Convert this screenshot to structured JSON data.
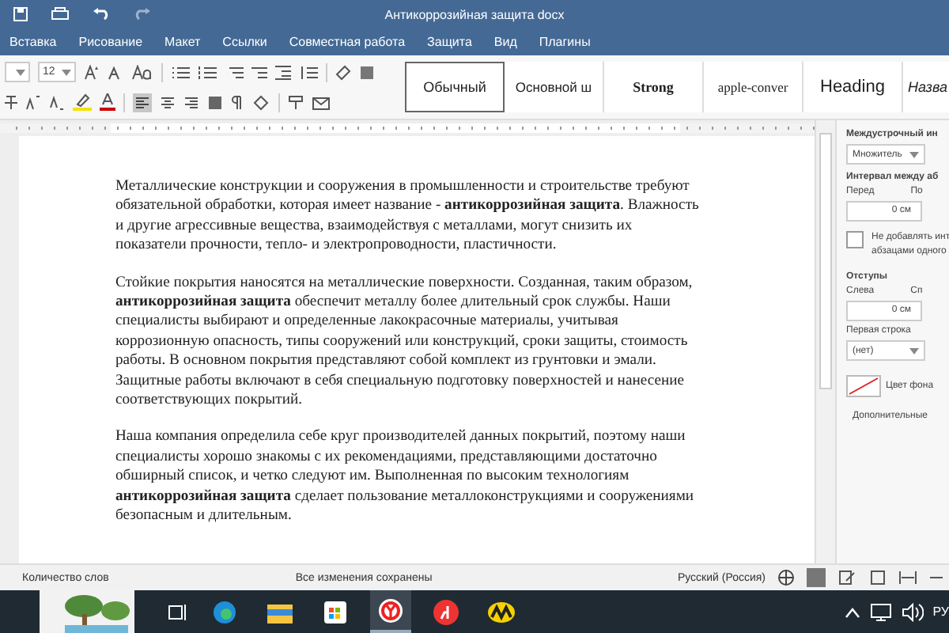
{
  "window": {
    "title": "Антикоррозийная защита docx"
  },
  "menu": [
    {
      "label": "Вставка",
      "selected": false
    },
    {
      "label": "Рисование",
      "selected": false
    },
    {
      "label": "Макет",
      "selected": false
    },
    {
      "label": "Ссылки",
      "selected": false
    },
    {
      "label": "Совместная работа",
      "selected": false
    },
    {
      "label": "Защита",
      "selected": false
    },
    {
      "label": "Вид",
      "selected": false
    },
    {
      "label": "Плагины",
      "selected": false
    }
  ],
  "toolbar": {
    "font_size": "12",
    "styles": [
      {
        "label": "Обычный",
        "kind": "normal",
        "selected": true
      },
      {
        "label": "Основной ш",
        "kind": "body",
        "selected": false
      },
      {
        "label": "Strong",
        "kind": "strong",
        "selected": false
      },
      {
        "label": "apple-conver",
        "kind": "serif",
        "selected": false
      },
      {
        "label": "Heading",
        "kind": "heading",
        "selected": false
      },
      {
        "label": "Назва",
        "kind": "title",
        "selected": false
      }
    ]
  },
  "document": {
    "paragraphs": [
      "Металлические конструкции и сооружения в промышленности и строительстве требуют обязательной обработки, которая имеет название - **антикоррозийная защита**. Влажность и другие агрессивные вещества, взаимодействуя с металлами, могут снизить их показатели прочности, тепло- и электропроводности, пластичности.",
      "Стойкие покрытия наносятся на металлические поверхности. Созданная, таким образом, **антикоррозийная защита** обеспечит металлу более длительный срок службы. Наши специалисты выбирают и определенные лакокрасочные материалы, учитывая коррозионную опасность, типы сооружений или конструкций, сроки защиты, стоимость работы. В основном покрытия представляют собой комплект из грунтовки и эмали. Защитные работы включают в себя специальную подготовку поверхностей и нанесение соответствующих покрытий.",
      "Наша компания определила себе круг производителей данных покрытий, поэтому наши специалисты хорошо знакомы с их рекомендациями, представляющими достаточно обширный список,  и четко следуют им. Выполненная по высоким технологиям **антикоррозийная защита** сделает пользование металлоконструкциями и сооружениями безопасным и длительным."
    ]
  },
  "paragraph_panel": {
    "line_spacing_title": "Междустрочный ин",
    "line_spacing_value": "Множитель",
    "spacing_title": "Интервал между аб",
    "before_label": "Перед",
    "after_label": "По",
    "before_value": "0 см",
    "no_spacing_label": "Не добавлять инт\nабзацами одного",
    "no_spacing_checked": false,
    "indents_title": "Отступы",
    "left_label": "Слева",
    "right_label": "Сп",
    "left_value": "0 см",
    "first_line_label": "Первая строка",
    "first_line_value": "(нет)",
    "background_label": "Цвет фона",
    "more_button": "Дополнительные"
  },
  "status_bar": {
    "word_count": "Количество слов",
    "save_status": "Все изменения сохранены",
    "language": "Русский (Россия)"
  },
  "taskbar": {
    "apps": [
      {
        "kind": "edge",
        "selected": false
      },
      {
        "kind": "folder",
        "selected": false
      },
      {
        "kind": "store",
        "selected": false
      },
      {
        "kind": "browser",
        "selected": true
      },
      {
        "kind": "ya",
        "selected": false
      },
      {
        "kind": "music",
        "selected": false
      }
    ],
    "language": "РУ"
  }
}
